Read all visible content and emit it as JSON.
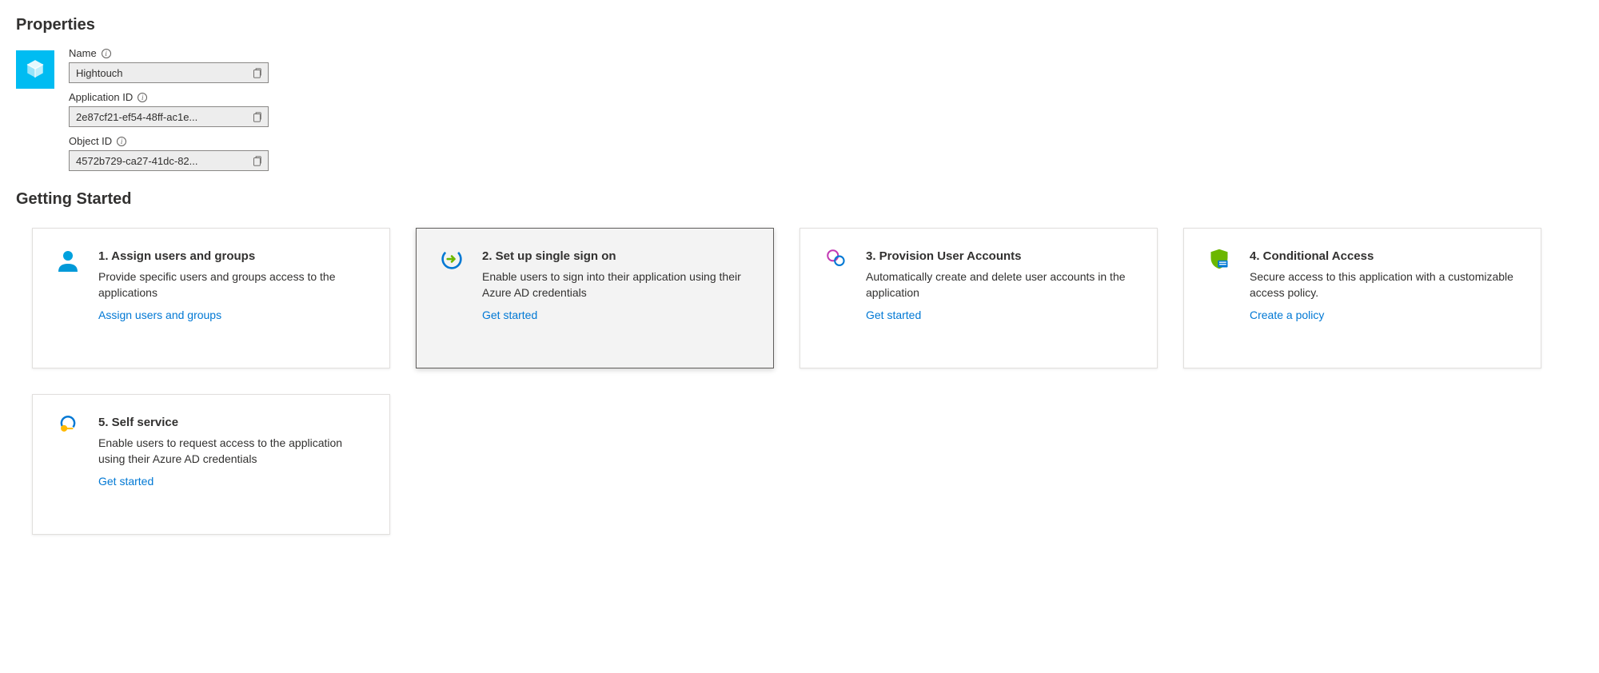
{
  "sections": {
    "properties_heading": "Properties",
    "getting_started_heading": "Getting Started"
  },
  "properties": {
    "name": {
      "label": "Name",
      "value": "Hightouch"
    },
    "application_id": {
      "label": "Application ID",
      "value": "2e87cf21-ef54-48ff-ac1e..."
    },
    "object_id": {
      "label": "Object ID",
      "value": "4572b729-ca27-41dc-82..."
    }
  },
  "cards": {
    "assign_users": {
      "title": "1. Assign users and groups",
      "desc": "Provide specific users and groups access to the applications",
      "link": "Assign users and groups",
      "selected": false
    },
    "sso": {
      "title": "2. Set up single sign on",
      "desc": "Enable users to sign into their application using their Azure AD credentials",
      "link": "Get started",
      "selected": true
    },
    "provision": {
      "title": "3. Provision User Accounts",
      "desc": "Automatically create and delete user accounts in the application",
      "link": "Get started",
      "selected": false
    },
    "conditional_access": {
      "title": "4. Conditional Access",
      "desc": "Secure access to this application with a customizable access policy.",
      "link": "Create a policy",
      "selected": false
    },
    "self_service": {
      "title": "5. Self service",
      "desc": "Enable users to request access to the application using their Azure AD credentials",
      "link": "Get started",
      "selected": false
    }
  }
}
